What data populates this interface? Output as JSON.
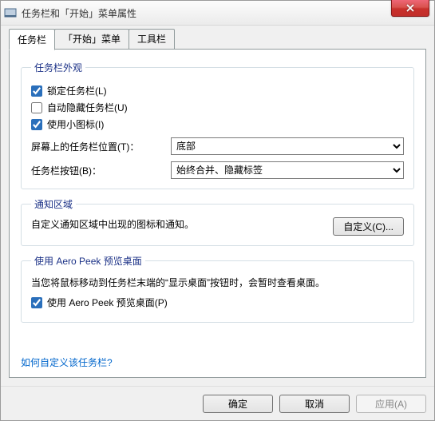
{
  "window": {
    "title": "任务栏和「开始」菜单属性"
  },
  "tabs": {
    "taskbar": "任务栏",
    "startmenu": "「开始」菜单",
    "toolbars": "工具栏"
  },
  "appearance": {
    "legend": "任务栏外观",
    "lock": "锁定任务栏(L)",
    "autohide": "自动隐藏任务栏(U)",
    "smallicons": "使用小图标(I)",
    "position_label": "屏幕上的任务栏位置(T)：",
    "position_value": "底部",
    "buttons_label": "任务栏按钮(B)：",
    "buttons_value": "始终合并、隐藏标签"
  },
  "notification": {
    "legend": "通知区域",
    "desc": "自定义通知区域中出现的图标和通知。",
    "customize_btn": "自定义(C)..."
  },
  "aero": {
    "legend": "使用 Aero Peek 预览桌面",
    "desc": "当您将鼠标移动到任务栏末端的“显示桌面”按钮时，会暂时查看桌面。",
    "checkbox": "使用 Aero Peek 预览桌面(P)"
  },
  "link": "如何自定义该任务栏?",
  "footer": {
    "ok": "确定",
    "cancel": "取消",
    "apply": "应用(A)"
  }
}
